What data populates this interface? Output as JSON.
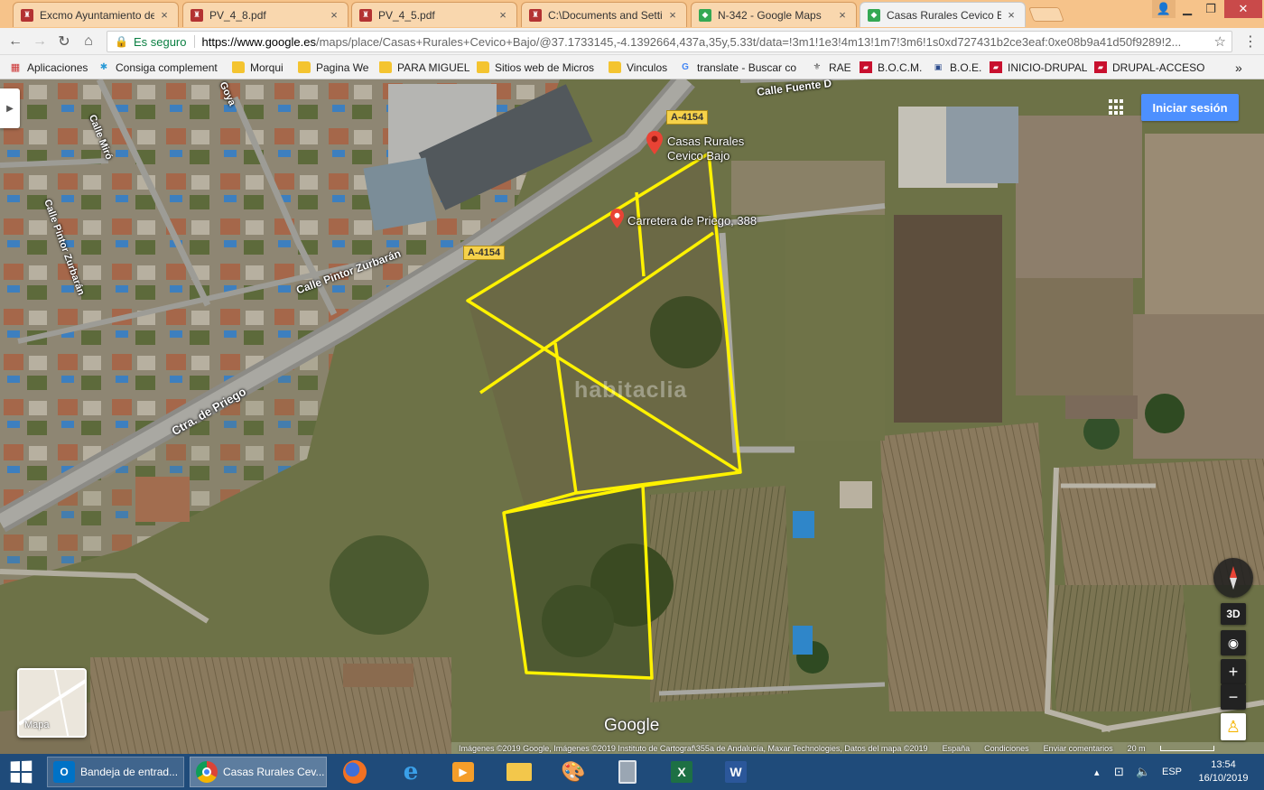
{
  "browser": {
    "tabs": [
      {
        "title": "Excmo Ayuntamiento de",
        "favicon": "castle-icon",
        "color": "#b33232"
      },
      {
        "title": "PV_4_8.pdf",
        "favicon": "castle-icon",
        "color": "#b33232"
      },
      {
        "title": "PV_4_5.pdf",
        "favicon": "castle-icon",
        "color": "#b33232"
      },
      {
        "title": "C:\\Documents and Settir",
        "favicon": "castle-icon",
        "color": "#b33232"
      },
      {
        "title": "N-342 - Google Maps",
        "favicon": "maps-icon",
        "color": "#34a853"
      },
      {
        "title": "Casas Rurales Cevico Baj",
        "favicon": "maps-icon",
        "color": "#34a853"
      }
    ],
    "tab_close_glyph": "×",
    "secure_label": "Es seguro",
    "url_domain": "https://www.google.es",
    "url_rest": "/maps/place/Casas+Rurales+Cevico+Bajo/@37.1733145,-4.1392664,437a,35y,5.33t/data=!3m1!1e3!4m13!1m7!3m6!1s0xd727431b2ce3eaf:0xe08b9a41d50f9289!2..."
  },
  "bookmarks": [
    {
      "label": "Aplicaciones",
      "icon": "apps-grid-icon"
    },
    {
      "label": "Consiga complement",
      "icon": "puzzle-icon"
    },
    {
      "label": "Morqui",
      "icon": "folder-icon"
    },
    {
      "label": "Pagina We",
      "icon": "folder-icon"
    },
    {
      "label": "PARA MIGUEL",
      "icon": "folder-icon"
    },
    {
      "label": "Sitios web de Micros",
      "icon": "folder-icon"
    },
    {
      "label": "Vinculos",
      "icon": "folder-icon"
    },
    {
      "label": "translate - Buscar co",
      "icon": "google-icon"
    },
    {
      "label": "RAE",
      "icon": "rae-icon"
    },
    {
      "label": "B.O.C.M.",
      "icon": "bocm-icon"
    },
    {
      "label": "B.O.E.",
      "icon": "boe-icon"
    },
    {
      "label": "INICIO-DRUPAL",
      "icon": "drupal-icon"
    },
    {
      "label": "DRUPAL-ACCESO",
      "icon": "drupal-icon"
    }
  ],
  "bookmarks_overflow": "»",
  "map": {
    "roads": {
      "calle_fuente": "Calle Fuente D",
      "calle_miro": "Calle Miró",
      "calle_pintor_zurbaran_v": "Calle Pintor Zurbarán",
      "calle_pintor_zurbaran_h": "Calle Pintor Zurbarán",
      "ctra_priego": "Ctra. de Priego",
      "calle_goya": "Goya"
    },
    "shields": [
      "A-4154",
      "A-4154"
    ],
    "places": [
      {
        "name_line1": "Casas Rurales",
        "name_line2": "Cevico Bajo"
      },
      {
        "name_line1": "Carretera de Priego, 388",
        "name_line2": ""
      }
    ],
    "watermark": "habitaclia",
    "signin_label": "Iniciar sesión",
    "minimap_label": "Mapa",
    "view_3d": "3D",
    "zoom_in": "+",
    "zoom_out": "−",
    "google_label": "Google",
    "footer": {
      "attribution": "Imágenes ©2019 Google, Imágenes ©2019 Instituto de Cartograf\\355a de Andalucía, Maxar Technologies, Datos del mapa ©2019",
      "country": "España",
      "terms": "Condiciones",
      "feedback": "Enviar comentarios",
      "scale": "20 m"
    }
  },
  "taskbar": {
    "apps": [
      {
        "label": "Bandeja de entrad...",
        "icon": "outlook-icon"
      },
      {
        "label": "Casas Rurales Cev...",
        "icon": "chrome-icon"
      }
    ],
    "lang": "ESP",
    "time": "13:54",
    "date": "16/10/2019"
  }
}
